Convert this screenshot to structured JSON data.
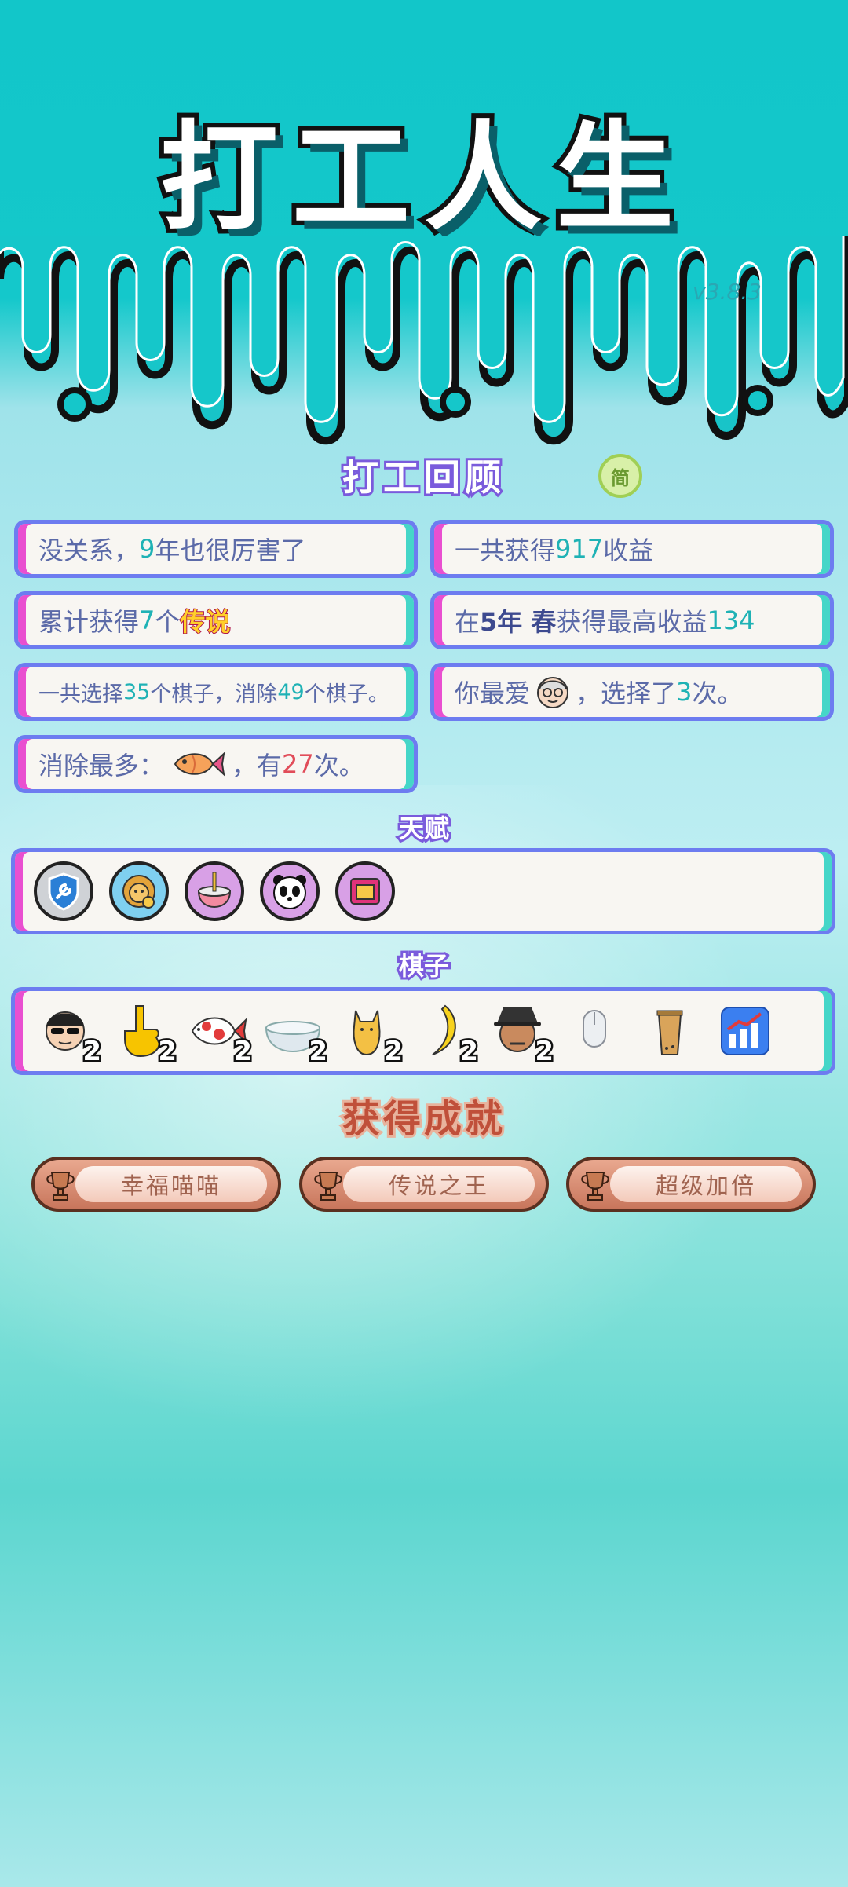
{
  "title": "打工人生",
  "version": "v3.8.3",
  "review": {
    "heading": "打工回顾",
    "simplify_label": "简",
    "stats": {
      "c1": {
        "pre": "没关系，",
        "num": "9",
        "post": "年也很厉害了"
      },
      "c2": {
        "pre": "一共获得",
        "num": "917",
        "post": "收益"
      },
      "c3": {
        "pre": "累计获得",
        "num": "7",
        "mid": "个",
        "legend": "传说"
      },
      "c4": {
        "pre": "在 ",
        "year": "5年 春",
        "mid": " 获得最高收益",
        "num": "134"
      },
      "c5": {
        "pre": "一共选择",
        "num1": "35",
        "mid": "个棋子，消除",
        "num2": "49",
        "post": "个棋子。"
      },
      "c6": {
        "pre": "你最爱",
        "mid": "，选择了",
        "num": "3",
        "post": "次。"
      },
      "c7": {
        "pre": "消除最多：",
        "mid": "，有",
        "num": "27",
        "post": "次。"
      }
    }
  },
  "talent": {
    "heading": "天赋",
    "icons": [
      "wrench-shield-icon",
      "lion-cub-icon",
      "rice-bowl-icon",
      "panda-icon",
      "gift-box-icon"
    ]
  },
  "pieces": {
    "heading": "棋子",
    "items": [
      {
        "icon": "sunglasses-man-icon",
        "count": "2"
      },
      {
        "icon": "pointing-hand-icon",
        "count": "2"
      },
      {
        "icon": "koi-fish-icon",
        "count": "2"
      },
      {
        "icon": "bowl-icon",
        "count": "2"
      },
      {
        "icon": "cat-icon",
        "count": "2"
      },
      {
        "icon": "banana-icon",
        "count": "2"
      },
      {
        "icon": "bucket-hat-man-icon",
        "count": "2"
      },
      {
        "icon": "mouse-icon",
        "count": ""
      },
      {
        "icon": "bubble-tea-icon",
        "count": ""
      },
      {
        "icon": "growth-chart-icon",
        "count": ""
      }
    ]
  },
  "achievements": {
    "heading": "获得成就",
    "items": [
      "幸福喵喵",
      "传说之王",
      "超级加倍"
    ]
  },
  "colors": {
    "accent_left": "#e94fd0",
    "accent_right": "#45d6c8",
    "card_border": "#6d7cf0",
    "highlight": "#1fb2b5",
    "highlight_red": "#e14c59"
  }
}
